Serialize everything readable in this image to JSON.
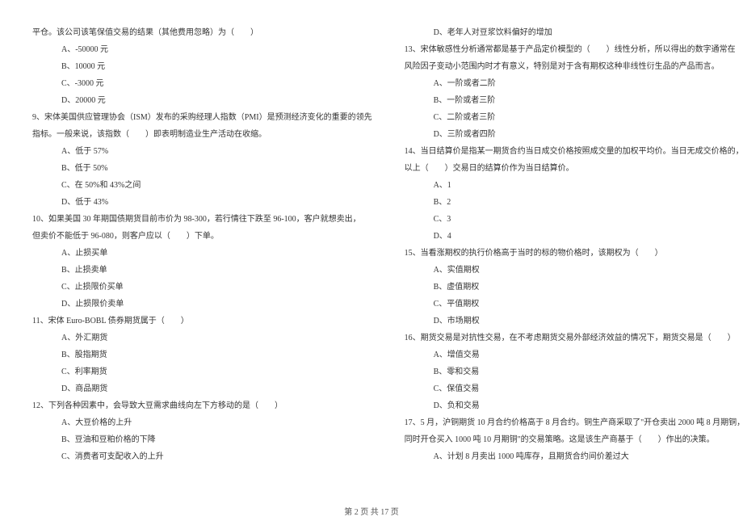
{
  "left_column": [
    {
      "indent": 0,
      "text": "平仓。该公司该笔保值交易的结果（其他费用忽略）为（　　）"
    },
    {
      "indent": 2,
      "text": "A、-50000 元"
    },
    {
      "indent": 2,
      "text": "B、10000 元"
    },
    {
      "indent": 2,
      "text": "C、-3000 元"
    },
    {
      "indent": 2,
      "text": "D、20000 元"
    },
    {
      "indent": 0,
      "text": "9、宋体美国供应管理协会（ISM）发布的采购经理人指数（PMI）是预测经济变化的重要的领先"
    },
    {
      "indent": 0,
      "text": "指标。一般来说，该指数（　　）即表明制造业生产活动在收缩。"
    },
    {
      "indent": 2,
      "text": "A、低于 57%"
    },
    {
      "indent": 2,
      "text": "B、低于 50%"
    },
    {
      "indent": 2,
      "text": "C、在 50%和 43%之间"
    },
    {
      "indent": 2,
      "text": "D、低于 43%"
    },
    {
      "indent": 0,
      "text": "10、如果美国 30 年期国债期货目前市价为 98-300，若行情往下跌至 96-100，客户就想卖出，"
    },
    {
      "indent": 0,
      "text": "但卖价不能低于 96-080，则客户应以（　　）下单。"
    },
    {
      "indent": 2,
      "text": "A、止损买单"
    },
    {
      "indent": 2,
      "text": "B、止损卖单"
    },
    {
      "indent": 2,
      "text": "C、止损限价买单"
    },
    {
      "indent": 2,
      "text": "D、止损限价卖单"
    },
    {
      "indent": 0,
      "text": "11、宋体 Euro-BOBL 债券期货属于（　　）"
    },
    {
      "indent": 2,
      "text": "A、外汇期货"
    },
    {
      "indent": 2,
      "text": "B、股指期货"
    },
    {
      "indent": 2,
      "text": "C、利率期货"
    },
    {
      "indent": 2,
      "text": "D、商品期货"
    },
    {
      "indent": 0,
      "text": "12、下列各种因素中，会导致大豆需求曲线向左下方移动的是（　　）"
    },
    {
      "indent": 2,
      "text": "A、大豆价格的上升"
    },
    {
      "indent": 2,
      "text": "B、豆油和豆粕价格的下降"
    },
    {
      "indent": 2,
      "text": "C、消费者可支配收入的上升"
    }
  ],
  "right_column": [
    {
      "indent": 2,
      "text": "D、老年人对豆浆饮料偏好的增加"
    },
    {
      "indent": 0,
      "text": "13、宋体敏感性分析通常都是基于产品定价模型的（　　）线性分析，所以得出的数字通常在"
    },
    {
      "indent": 0,
      "text": "风险因子变动小范围内时才有意义，特别是对于含有期权这种非线性衍生品的产品而言。"
    },
    {
      "indent": 2,
      "text": "A、一阶或者二阶"
    },
    {
      "indent": 2,
      "text": "B、一阶或者三阶"
    },
    {
      "indent": 2,
      "text": "C、二阶或者三阶"
    },
    {
      "indent": 2,
      "text": "D、三阶或者四阶"
    },
    {
      "indent": 0,
      "text": "14、当日结算价是指某一期货合约当日成交价格按照成交量的加权平均价。当日无成交价格的，"
    },
    {
      "indent": 0,
      "text": "以上（　　）交易日的结算价作为当日结算价。"
    },
    {
      "indent": 2,
      "text": "A、1"
    },
    {
      "indent": 2,
      "text": "B、2"
    },
    {
      "indent": 2,
      "text": "C、3"
    },
    {
      "indent": 2,
      "text": "D、4"
    },
    {
      "indent": 0,
      "text": "15、当看涨期权的执行价格高于当时的标的物价格时，该期权为（　　）"
    },
    {
      "indent": 2,
      "text": "A、实值期权"
    },
    {
      "indent": 2,
      "text": "B、虚值期权"
    },
    {
      "indent": 2,
      "text": "C、平值期权"
    },
    {
      "indent": 2,
      "text": "D、市场期权"
    },
    {
      "indent": 0,
      "text": "16、期货交易是对抗性交易，在不考虑期货交易外部经济效益的情况下，期货交易是（　　）"
    },
    {
      "indent": 2,
      "text": "A、增值交易"
    },
    {
      "indent": 2,
      "text": "B、零和交易"
    },
    {
      "indent": 2,
      "text": "C、保值交易"
    },
    {
      "indent": 2,
      "text": "D、负和交易"
    },
    {
      "indent": 0,
      "text": "17、5 月，沪铜期货 10 月合约价格高于 8 月合约。铜生产商采取了\"开仓卖出 2000 吨 8 月期铜，"
    },
    {
      "indent": 0,
      "text": "同时开仓买入 1000 吨 10 月期铜\"的交易策略。这是该生产商基于（　　）作出的决策。"
    },
    {
      "indent": 2,
      "text": "A、计划 8 月卖出 1000 吨库存，且期货合约间价差过大"
    }
  ],
  "footer": "第 2 页 共 17 页"
}
